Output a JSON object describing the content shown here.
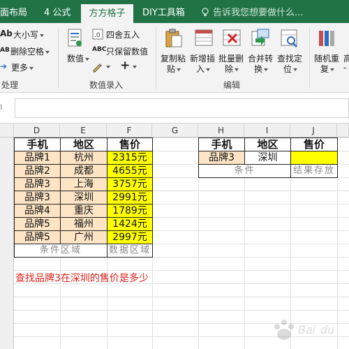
{
  "ribbon_tabs": [
    "面布局",
    "4 公式",
    "方方格子",
    "DIY工具箱"
  ],
  "active_tab": "方方格子",
  "tell_me": "告诉我您想要做什么...",
  "ribbon": {
    "case": "大小写",
    "delete_space": "删除空格",
    "more": "更多",
    "process_label": "处理",
    "numeric": "数值",
    "round": "四舍五入",
    "keep_numeric": "只保留数值",
    "numeric_entry_label": "数值录入",
    "copy_paste_line1": "复制粘",
    "copy_paste_line2": "贴",
    "new_insert_line1": "新增插",
    "new_insert_line2": "入",
    "batch_delete_line1": "批量删",
    "batch_delete_line2": "除",
    "merge_convert_line1": "合并转",
    "merge_convert_line2": "换",
    "find_locate_line1": "查找定",
    "find_locate_line2": "位",
    "edit_label": "编辑",
    "random_line1": "随机重",
    "random_line2": "复",
    "high_line1": "高",
    "high_line2": "-"
  },
  "columns": [
    "D",
    "E",
    "F",
    "G",
    "H",
    "I",
    "J"
  ],
  "left_table": {
    "headers": [
      "手机",
      "地区",
      "售价"
    ],
    "rows": [
      [
        "品牌1",
        "杭州",
        "2315元"
      ],
      [
        "品牌2",
        "成都",
        "4655元"
      ],
      [
        "品牌3",
        "上海",
        "3757元"
      ],
      [
        "品牌3",
        "深圳",
        "2991元"
      ],
      [
        "品牌4",
        "重庆",
        "1789元"
      ],
      [
        "品牌5",
        "福州",
        "1424元"
      ],
      [
        "品牌5",
        "广州",
        "2997元"
      ]
    ],
    "condition_area": "条件区域",
    "data_area": "数据区域"
  },
  "right_table": {
    "headers": [
      "手机",
      "地区",
      "售价"
    ],
    "row": [
      "品牌3",
      "深圳",
      ""
    ],
    "condition": "条件",
    "result": "结果存放"
  },
  "caption": "查找品牌3在深圳的售价是多少",
  "colors": {
    "ribbon_green": "#217346",
    "peach": "#fce4c4",
    "yellow": "#ffff00",
    "caption_red": "#e0201a"
  }
}
